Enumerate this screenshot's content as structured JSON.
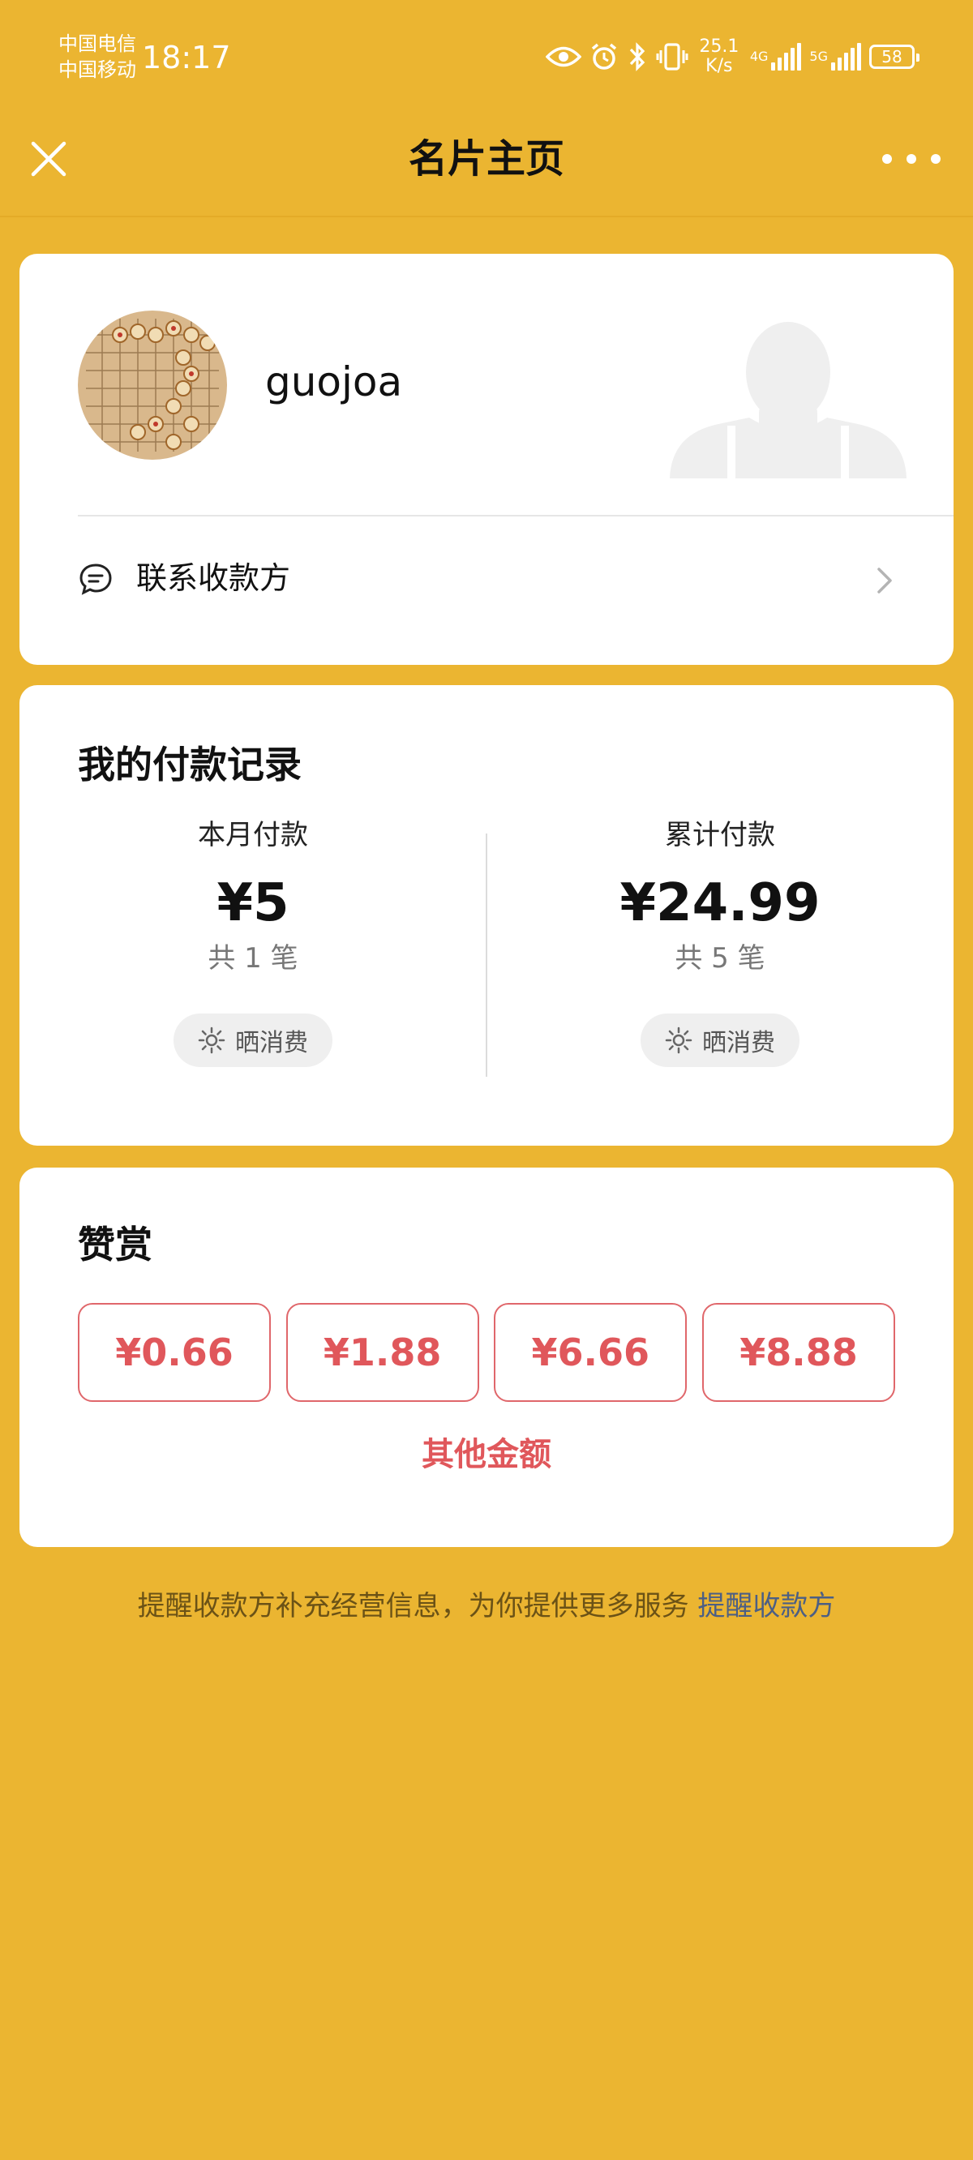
{
  "status_bar": {
    "carrier_1": "中国电信",
    "carrier_2": "中国移动",
    "time": "18:17",
    "net_speed_value": "25.1",
    "net_speed_unit": "K/s",
    "net_type_1": "4G",
    "net_type_2": "5G",
    "battery": "58",
    "icons": [
      "eye-icon",
      "alarm-icon",
      "bluetooth-icon",
      "vibrate-icon",
      "signal-icon",
      "battery-icon"
    ]
  },
  "navbar": {
    "title": "名片主页",
    "close_icon": "close-icon",
    "more_icon": "more-icon"
  },
  "profile": {
    "username": "guojoa",
    "contact_label": "联系收款方",
    "contact_icon": "chat-bubble-icon",
    "chevron_icon": "chevron-right-icon"
  },
  "records": {
    "title": "我的付款记录",
    "month": {
      "label": "本月付款",
      "amount": "¥5",
      "count": "共 1 笔",
      "share_label": "晒消费"
    },
    "total": {
      "label": "累计付款",
      "amount": "¥24.99",
      "count": "共 5 笔",
      "share_label": "晒消费"
    }
  },
  "tips": {
    "title": "赞赏",
    "options": [
      "¥0.66",
      "¥1.88",
      "¥6.66",
      "¥8.88"
    ],
    "other_label": "其他金额"
  },
  "footer": {
    "text": "提醒收款方补充经营信息，为你提供更多服务",
    "link": "提醒收款方"
  },
  "colors": {
    "background": "#ebb531",
    "accent_red": "#e0575b",
    "link_blue": "#4c5f84"
  }
}
